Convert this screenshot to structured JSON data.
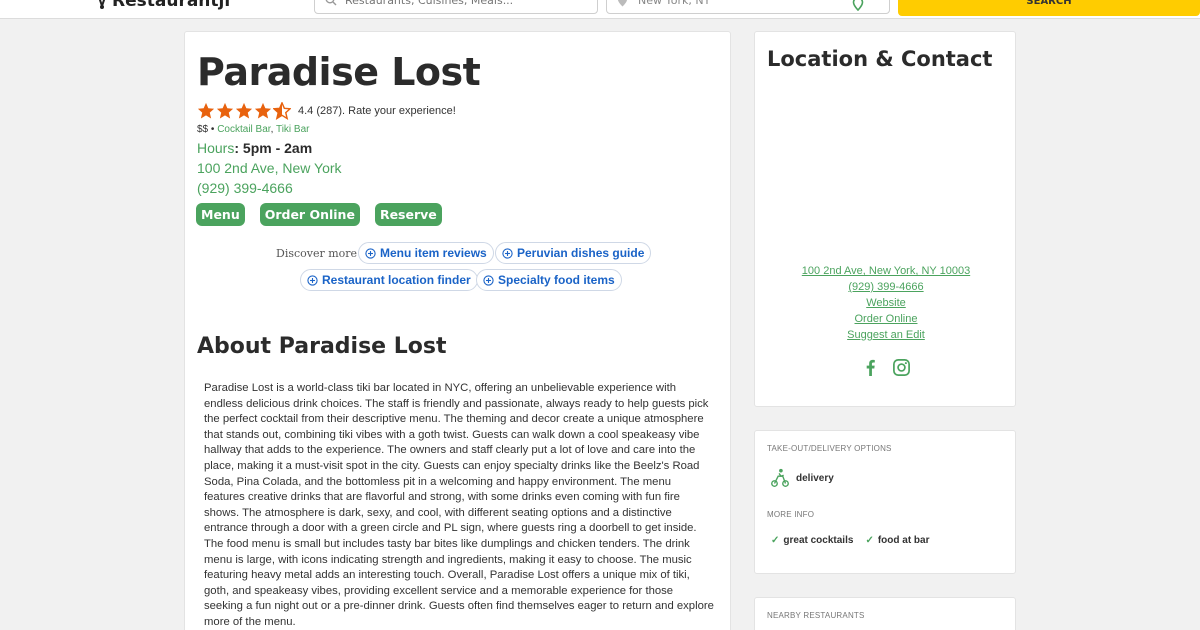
{
  "header": {
    "logo_text": "Restaurantji",
    "search_placeholder": "Restaurants, Cuisines, Meals...",
    "location_value": "New York, NY",
    "search_button": "SEARCH"
  },
  "restaurant": {
    "name": "Paradise Lost",
    "rating": 4.4,
    "rating_text": "4.4 (287). Rate your experience!",
    "price": "$$",
    "separator": "•",
    "categories": [
      "Cocktail Bar",
      "Tiki Bar"
    ],
    "category_comma": ",",
    "hours_label": "Hours",
    "hours_colon": ":",
    "hours_value": "5pm - 2am",
    "address": "100 2nd Ave, New York",
    "phone": "(929) 399-4666",
    "buttons": {
      "menu": "Menu",
      "order": "Order Online",
      "reserve": "Reserve"
    }
  },
  "discover": {
    "label": "Discover more",
    "chips": [
      "Menu item reviews",
      "Peruvian dishes guide",
      "Restaurant location finder",
      "Specialty food items"
    ]
  },
  "about": {
    "title": "About Paradise Lost",
    "text": "Paradise Lost is a world-class tiki bar located in NYC, offering an unbelievable experience with endless delicious drink choices. The staff is friendly and passionate, always ready to help guests pick the perfect cocktail from their descriptive menu. The theming and decor create a unique atmosphere that stands out, combining tiki vibes with a goth twist. Guests can walk down a cool speakeasy vibe hallway that adds to the experience. The owners and staff clearly put a lot of love and care into the place, making it a must-visit spot in the city. Guests can enjoy specialty drinks like the Beelz's Road Soda, Pina Colada, and the bottomless pit in a welcoming and happy environment. The menu features creative drinks that are flavorful and strong, with some drinks even coming with fun fire shows. The atmosphere is dark, sexy, and cool, with different seating options and a distinctive entrance through a door with a green circle and PL sign, where guests ring a doorbell to get inside. The food menu is small but includes tasty bar bites like dumplings and chicken tenders. The drink menu is large, with icons indicating strength and ingredients, making it easy to choose. The music featuring heavy metal adds an interesting touch. Overall, Paradise Lost offers a unique mix of tiki, goth, and speakeasy vibes, providing excellent service and a memorable experience for those seeking a fun night out or a pre-dinner drink. Guests often find themselves eager to return and explore more of the menu."
  },
  "contact": {
    "title": "Location & Contact",
    "address": "100 2nd Ave, New York, NY 10003",
    "phone": "(929) 399-4666",
    "website": "Website",
    "order_online": "Order Online",
    "suggest_edit": "Suggest an Edit"
  },
  "options": {
    "takeout_heading": "TAKE-OUT/DELIVERY OPTIONS",
    "delivery": "delivery",
    "more_info_heading": "MORE INFO",
    "features": [
      "great cocktails",
      "food at bar"
    ]
  },
  "nearby": {
    "heading": "NEARBY RESTAURANTS"
  },
  "colors": {
    "accent_green": "#4ba35e",
    "star_orange": "#e8620e",
    "search_yellow": "#ffcc00",
    "chip_blue": "#1a63c7"
  }
}
